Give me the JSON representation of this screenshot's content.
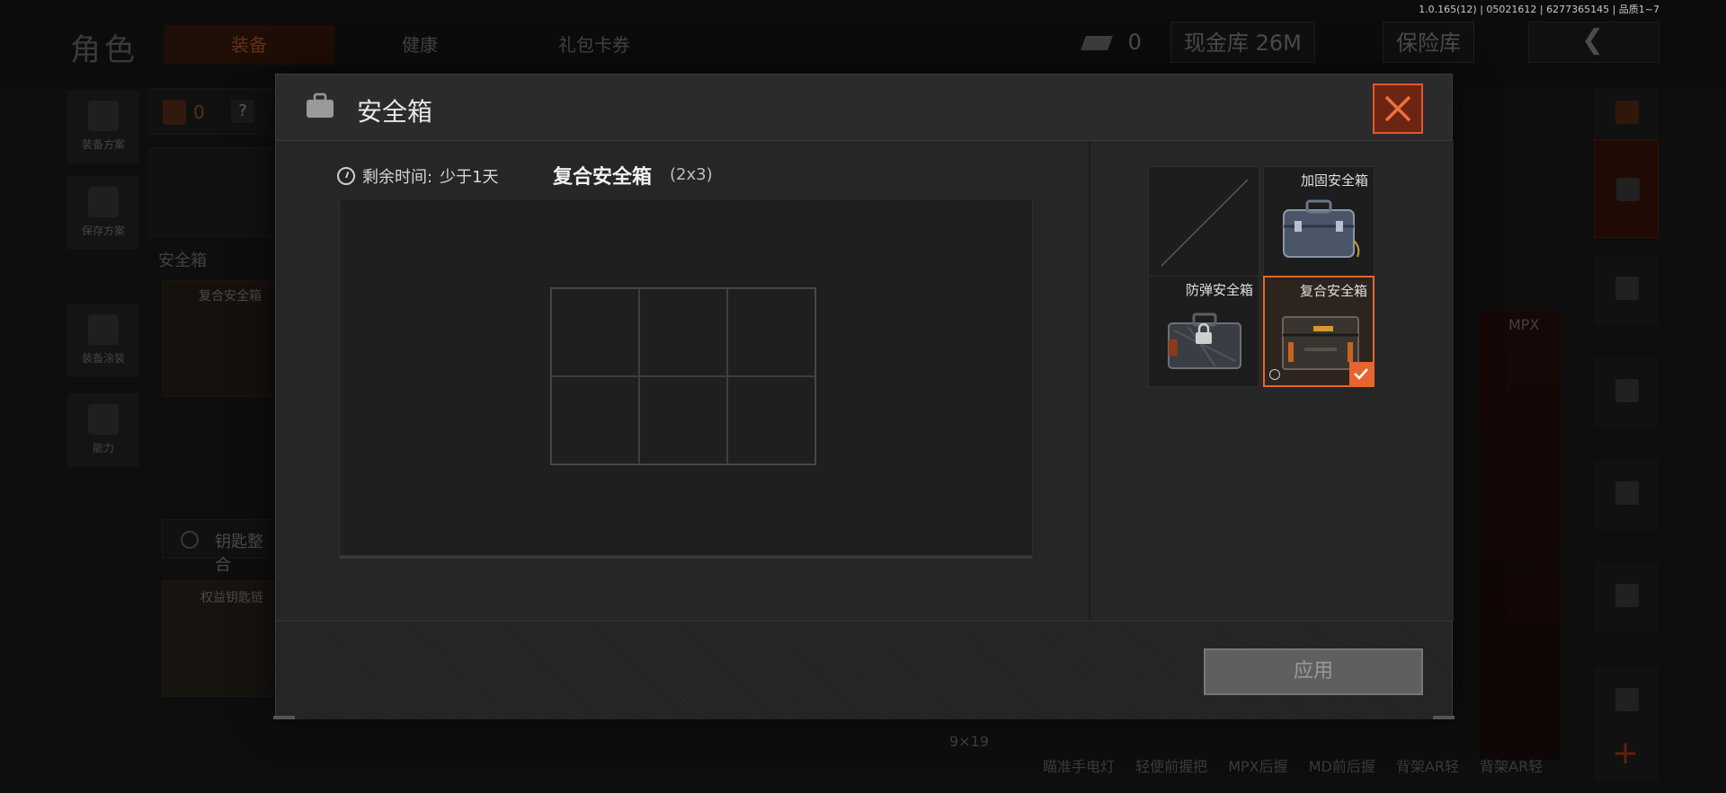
{
  "version_info": "1.0.165(12) | 05021612 | 6277365145 | 品质1~7",
  "background": {
    "section_title": "角色",
    "tabs": [
      {
        "label": "装备",
        "active": true
      },
      {
        "label": "健康",
        "active": false
      },
      {
        "label": "礼包卡券",
        "active": false
      }
    ],
    "currency_count": "0",
    "cash_vault": "现金库 26M",
    "safe_vault": "保险库",
    "left_menu": [
      "装备方案",
      "保存方案",
      "装备涂装",
      "能力"
    ],
    "backpack_count": "0",
    "backpack_help": "?",
    "safe_box_label": "安全箱",
    "safe_box_item": "复合安全箱",
    "key_section": "钥匙整合",
    "item_card": "权益钥匙链",
    "weapon_name": "MPX",
    "ammo_label": "9×19",
    "bottom_tags": [
      "瞄准手电灯",
      "轻便前握把",
      "MPX后握",
      "MD前后握",
      "背架AR轻",
      "背架AR轻"
    ]
  },
  "modal": {
    "title": "安全箱",
    "remaining_time_label": "剩余时间:",
    "remaining_time_value": "少于1天",
    "current_case_name": "复合安全箱",
    "current_case_size": "(2x3)",
    "case_options": [
      {
        "label": "",
        "state": "empty"
      },
      {
        "label": "加固安全箱",
        "state": "available"
      },
      {
        "label": "防弹安全箱",
        "state": "locked"
      },
      {
        "label": "复合安全箱",
        "state": "selected"
      }
    ],
    "apply_label": "应用"
  },
  "colors": {
    "accent": "#e6652d",
    "close_bg": "#6b2512",
    "modal_bg": "#262626"
  }
}
